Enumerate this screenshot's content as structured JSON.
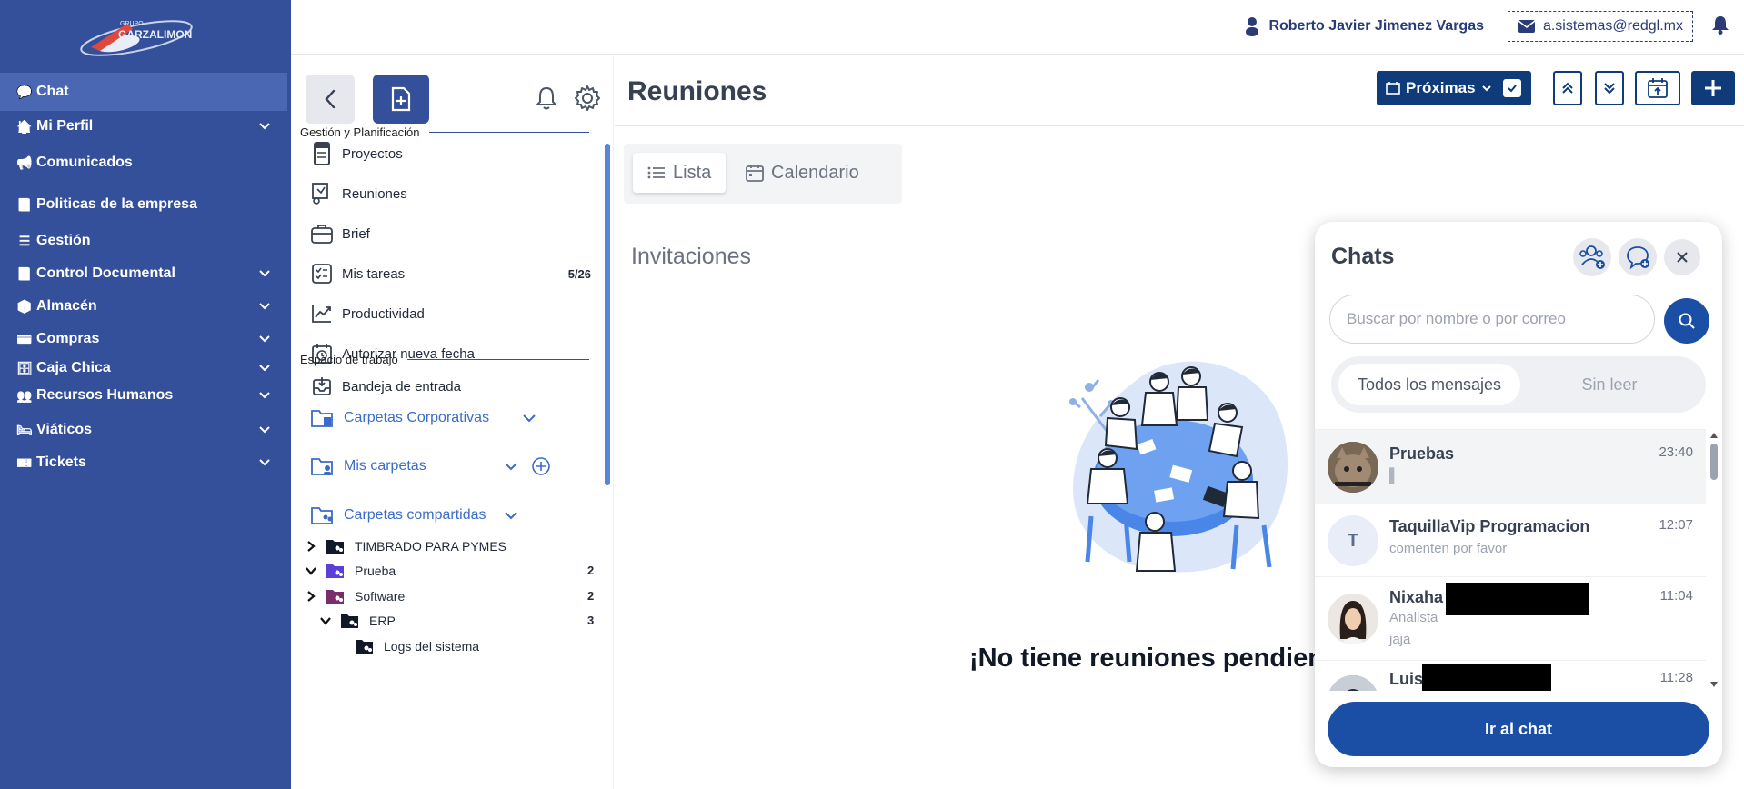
{
  "sidebar": {
    "items": [
      {
        "label": "Chat",
        "icon": "chat-icon",
        "glyph": "💬",
        "active": true
      },
      {
        "label": "Mi Perfil",
        "icon": "home-icon",
        "glyph": "🏠",
        "expandable": true
      },
      {
        "label": "Comunicados",
        "icon": "megaphone-icon",
        "glyph": "📢"
      },
      {
        "label": "Politicas de la empresa",
        "icon": "book-icon",
        "glyph": "📘"
      },
      {
        "label": "Gestión",
        "icon": "list-icon",
        "glyph": "☰"
      },
      {
        "label": "Control Documental",
        "icon": "book-icon",
        "glyph": "📘",
        "expandable": true
      },
      {
        "label": "Almacén",
        "icon": "boxes-icon",
        "glyph": "📦",
        "expandable": true
      },
      {
        "label": "Compras",
        "icon": "credit-card-icon",
        "glyph": "💳",
        "expandable": true
      },
      {
        "label": "Caja Chica",
        "icon": "archive-icon",
        "glyph": "🗄",
        "expandable": true
      },
      {
        "label": "Recursos Humanos",
        "icon": "users-icon",
        "glyph": "👥",
        "expandable": true
      },
      {
        "label": "Viáticos",
        "icon": "bed-icon",
        "glyph": "🛏",
        "expandable": true
      },
      {
        "label": "Tickets",
        "icon": "ticket-icon",
        "glyph": "🎫",
        "expandable": true
      }
    ]
  },
  "header": {
    "user_name": "Roberto Javier Jimenez Vargas",
    "email": "a.sistemas@redgl.mx"
  },
  "panel": {
    "section1": "Gestión y Planificación",
    "items1": [
      {
        "label": "Proyectos",
        "icon": "notebook-icon"
      },
      {
        "label": "Reuniones",
        "icon": "meeting-icon"
      },
      {
        "label": "Brief",
        "icon": "briefcase-icon"
      },
      {
        "label": "Mis tareas",
        "icon": "checklist-icon",
        "count": "5/26"
      },
      {
        "label": "Productividad",
        "icon": "trend-icon"
      },
      {
        "label": "Autorizar nueva fecha",
        "icon": "calendar-clock-icon"
      }
    ],
    "section2": "Espacio de trabajo",
    "inbox": "Bandeja de entrada",
    "folders": [
      {
        "label": "Carpetas Corporativas"
      },
      {
        "label": "Mis carpetas"
      },
      {
        "label": "Carpetas compartidas"
      }
    ],
    "tree": [
      {
        "label": "TIMBRADO PARA PYMES",
        "count": "",
        "color": "#111827"
      },
      {
        "label": "Prueba",
        "count": "2",
        "color": "#5b3fd6"
      },
      {
        "label": "Software",
        "count": "2",
        "color": "#7b2d6b"
      },
      {
        "label": "ERP",
        "count": "3",
        "color": "#111827"
      },
      {
        "label": "Logs del sistema",
        "count": "",
        "color": "#111827"
      }
    ]
  },
  "main": {
    "title": "Reuniones",
    "filter_label": "Próximas",
    "tabs": [
      "Lista",
      "Calendario"
    ],
    "subtitle": "Invitaciones",
    "empty_message": "¡No tiene reuniones pendientes!"
  },
  "chat": {
    "title": "Chats",
    "search_placeholder": "Buscar por nombre o por correo",
    "tabs": [
      "Todos los mensajes",
      "Sin leer"
    ],
    "rows": [
      {
        "name": "Pruebas",
        "sub": "▌",
        "sub2": "",
        "time": "23:40",
        "avatar": "photo-cat"
      },
      {
        "name": "TaquillaVip Programacion",
        "sub": "comenten por favor",
        "sub2": "",
        "time": "12:07",
        "avatar": "T"
      },
      {
        "name": "Nixaha",
        "sub": "Analista",
        "sub2": "jaja",
        "time": "11:04",
        "avatar": "photo-woman"
      },
      {
        "name": "Luis",
        "sub": "",
        "sub2": "",
        "time": "11:28",
        "avatar": "photo-man"
      }
    ],
    "go_button": "Ir al chat"
  }
}
